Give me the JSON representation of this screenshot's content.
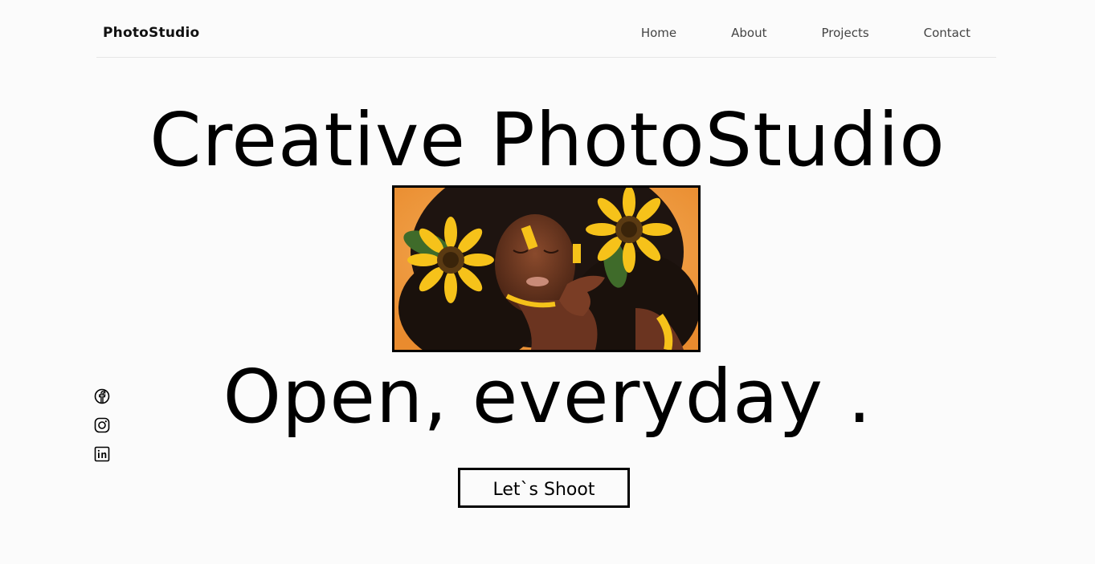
{
  "header": {
    "brand": "PhotoStudio",
    "nav": [
      {
        "label": "Home"
      },
      {
        "label": "About"
      },
      {
        "label": "Projects"
      },
      {
        "label": "Contact"
      }
    ]
  },
  "hero": {
    "title": "Creative PhotoStudio",
    "image_alt": "woman with sunflowers in hair",
    "tagline": "Open, everyday .",
    "cta_label": "Let`s Shoot"
  },
  "social": {
    "items": [
      {
        "name": "facebook-icon"
      },
      {
        "name": "instagram-icon"
      },
      {
        "name": "linkedin-icon"
      }
    ]
  },
  "colors": {
    "background": "#fbfbfb",
    "text": "#000000",
    "nav_text": "#444444",
    "image_background": "#f5a34a",
    "sunflower": "#f6c21a"
  }
}
